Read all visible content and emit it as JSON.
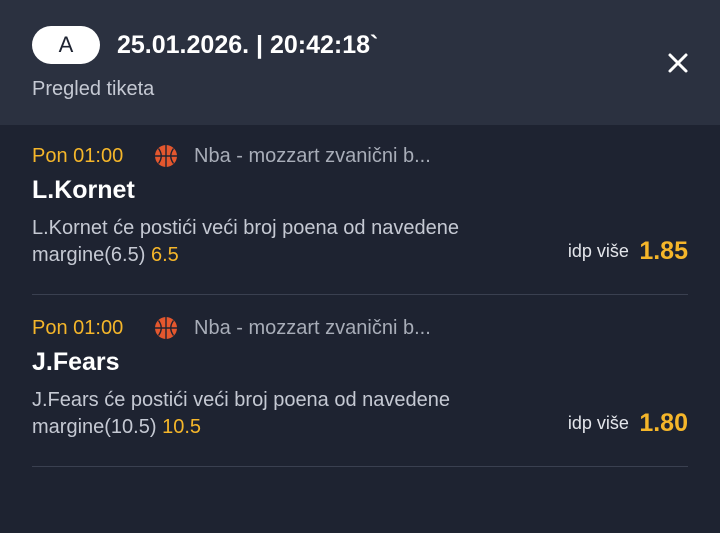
{
  "header": {
    "badge": "A",
    "datetime": "25.01.2026. | 20:42:18`",
    "subtitle": "Pregled tiketa",
    "close_icon": "close-icon"
  },
  "bets": [
    {
      "time": "Pon 01:00",
      "sport_icon": "basketball-icon",
      "league": "Nba - mozzart zvanični b...",
      "player": "L.Kornet",
      "description_line1": "L.Kornet će postići veći broj poena od navedene",
      "description_line2": "margine(6.5)",
      "line_value": "6.5",
      "pick": "idp više",
      "odds": "1.85"
    },
    {
      "time": "Pon 01:00",
      "sport_icon": "basketball-icon",
      "league": "Nba - mozzart zvanični b...",
      "player": "J.Fears",
      "description_line1": "J.Fears će postići veći broj poena od navedene",
      "description_line2": "margine(10.5)",
      "line_value": "10.5",
      "pick": "idp više",
      "odds": "1.80"
    }
  ],
  "colors": {
    "background": "#1e2331",
    "header": "#2b3140",
    "accent": "#f5b62a",
    "basketball": "#e4572e"
  }
}
